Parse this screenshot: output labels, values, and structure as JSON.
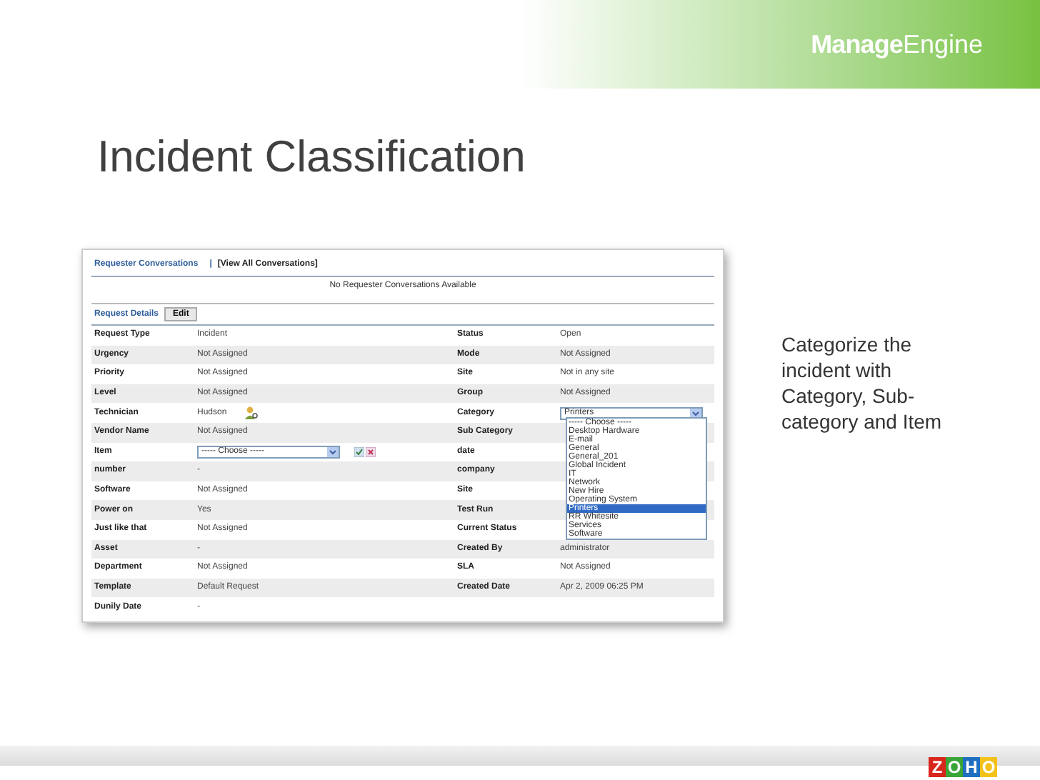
{
  "brand": {
    "first": "Manage",
    "second": "Engine"
  },
  "title": "Incident Classification",
  "app": {
    "conversations_label": "Requester Conversations",
    "separator": "|",
    "view_all": "[View All Conversations]",
    "empty_message": "No Requester Conversations Available",
    "details_label": "Request Details",
    "edit_button": "Edit",
    "rows": [
      {
        "left": {
          "label": "Request Type",
          "value": "Incident",
          "kind": "text"
        },
        "right": {
          "label": "Status",
          "value": "Open",
          "kind": "text"
        }
      },
      {
        "left": {
          "label": "Urgency",
          "value": "Not Assigned",
          "kind": "text"
        },
        "right": {
          "label": "Mode",
          "value": "Not Assigned",
          "kind": "text"
        }
      },
      {
        "left": {
          "label": "Priority",
          "value": "Not Assigned",
          "kind": "text"
        },
        "right": {
          "label": "Site",
          "value": "Not in any site",
          "kind": "text"
        }
      },
      {
        "left": {
          "label": "Level",
          "value": "Not Assigned",
          "kind": "text"
        },
        "right": {
          "label": "Group",
          "value": "Not Assigned",
          "kind": "text"
        }
      },
      {
        "left": {
          "label": "Technician",
          "value": "Hudson",
          "kind": "person"
        },
        "right": {
          "label": "Category",
          "value": "Printers",
          "kind": "select"
        }
      },
      {
        "left": {
          "label": "Vendor Name",
          "value": "Not Assigned",
          "kind": "text"
        },
        "right": {
          "label": "Sub Category",
          "kind": "text"
        }
      },
      {
        "left": {
          "label": "Item",
          "value": "----- Choose -----",
          "kind": "select"
        },
        "right": {
          "label": "date",
          "kind": "text"
        }
      },
      {
        "left": {
          "label": "number",
          "value": "-",
          "kind": "text"
        },
        "right": {
          "label": "company",
          "kind": "text"
        }
      },
      {
        "left": {
          "label": "Software",
          "value": "Not Assigned",
          "kind": "text"
        },
        "right": {
          "label": "Site",
          "kind": "text"
        }
      },
      {
        "left": {
          "label": "Power on",
          "value": "Yes",
          "kind": "text"
        },
        "right": {
          "label": "Test Run",
          "kind": "text"
        }
      },
      {
        "left": {
          "label": "Just like that",
          "value": "Not Assigned",
          "kind": "text"
        },
        "right": {
          "label": "Current Status",
          "kind": "text"
        }
      },
      {
        "left": {
          "label": "Asset",
          "value": "-",
          "kind": "text"
        },
        "right": {
          "label": "Created By",
          "value": "administrator",
          "kind": "text"
        }
      },
      {
        "left": {
          "label": "Department",
          "value": "Not Assigned",
          "kind": "text"
        },
        "right": {
          "label": "SLA",
          "value": "Not Assigned",
          "kind": "text"
        }
      },
      {
        "left": {
          "label": "Template",
          "value": "Default Request",
          "kind": "text"
        },
        "right": {
          "label": "Created Date",
          "value": "Apr 2, 2009 06:25 PM",
          "kind": "text"
        }
      },
      {
        "left": {
          "label": "Dunily Date",
          "value": "-",
          "kind": "text"
        }
      }
    ],
    "category_options": [
      {
        "label": "----- Choose -----",
        "selected": false
      },
      {
        "label": "Desktop Hardware",
        "selected": false
      },
      {
        "label": "E-mail",
        "selected": false
      },
      {
        "label": "General",
        "selected": false
      },
      {
        "label": "General_201",
        "selected": false
      },
      {
        "label": "Global Incident",
        "selected": false
      },
      {
        "label": "IT",
        "selected": false
      },
      {
        "label": "Network",
        "selected": false
      },
      {
        "label": "New Hire",
        "selected": false
      },
      {
        "label": "Operating System",
        "selected": false
      },
      {
        "label": "Printers",
        "selected": true
      },
      {
        "label": "RR Whitesite",
        "selected": false
      },
      {
        "label": "Services",
        "selected": false
      },
      {
        "label": "Software",
        "selected": false
      }
    ]
  },
  "callout": "Categorize the incident with Category, Sub-category and Item",
  "footer_logo": [
    {
      "letter": "Z",
      "color": "#d9261c"
    },
    {
      "letter": "O",
      "color": "#3aa537"
    },
    {
      "letter": "H",
      "color": "#1f6fc1"
    },
    {
      "letter": "O",
      "color": "#f2c21b"
    }
  ]
}
